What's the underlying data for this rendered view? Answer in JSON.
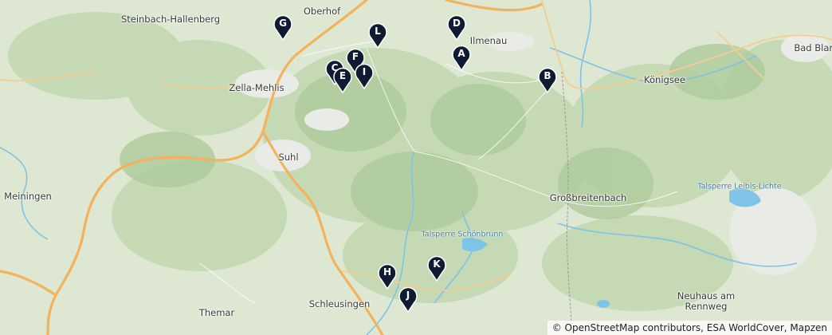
{
  "places": {
    "oberhof": "Oberhof",
    "steinbach": "Steinbach-Hallenberg",
    "ilmenau": "Ilmenau",
    "bad_blan": "Bad Blan",
    "konigsee": "Königsee",
    "zella": "Zella-Mehlis",
    "suhl": "Suhl",
    "meiningen": "Meiningen",
    "grossbreitenbach": "Großbreitenbach",
    "schleusingen": "Schleusingen",
    "themar": "Themar",
    "neuhaus": "Neuhaus am\nRennweg"
  },
  "water": {
    "schoenbrunn": "Talsperre Schönbrunn",
    "leibis": "Talsperre Leibis-Lichte"
  },
  "markers": [
    "A",
    "B",
    "C",
    "D",
    "E",
    "F",
    "G",
    "H",
    "I",
    "J",
    "K",
    "L"
  ],
  "attribution": "© OpenStreetMap contributors, ESA WorldCover, Mapzen",
  "colors": {
    "marker": "#0f1b33",
    "road": "#f3b25c",
    "water": "#7fc3e6",
    "forest": "#b6cfa4"
  }
}
